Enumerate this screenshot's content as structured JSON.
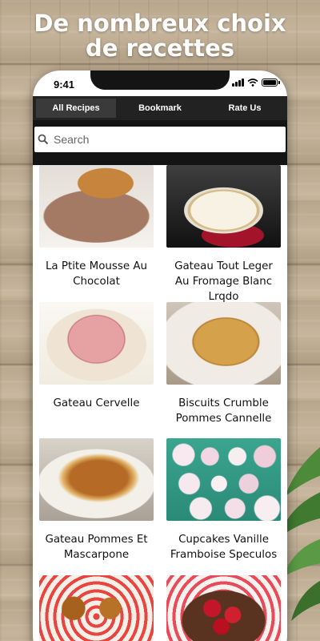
{
  "headline": {
    "line1": "De nombreux choix",
    "line2": "de recettes"
  },
  "status_bar": {
    "time": "9:41"
  },
  "tabs": [
    {
      "label": "All Recipes",
      "active": true
    },
    {
      "label": "Bookmark",
      "active": false
    },
    {
      "label": "Rate Us",
      "active": false
    }
  ],
  "search": {
    "placeholder": "Search",
    "value": ""
  },
  "recipes": [
    {
      "title": "La Ptite Mousse Au Chocolat"
    },
    {
      "title": "Gateau Tout Leger Au Fromage Blanc Lrqdo"
    },
    {
      "title": "Gateau Cervelle"
    },
    {
      "title": "Biscuits Crumble Pommes Cannelle"
    },
    {
      "title": "Gateau Pommes Et Mascarpone"
    },
    {
      "title": "Cupcakes Vanille Framboise Speculos"
    },
    {
      "title": ""
    },
    {
      "title": ""
    }
  ],
  "colors": {
    "tabbar_bg": "#222222",
    "tab_active_bg": "#3a3a3a",
    "phone_frame": "#141414",
    "card_text": "#111111"
  }
}
